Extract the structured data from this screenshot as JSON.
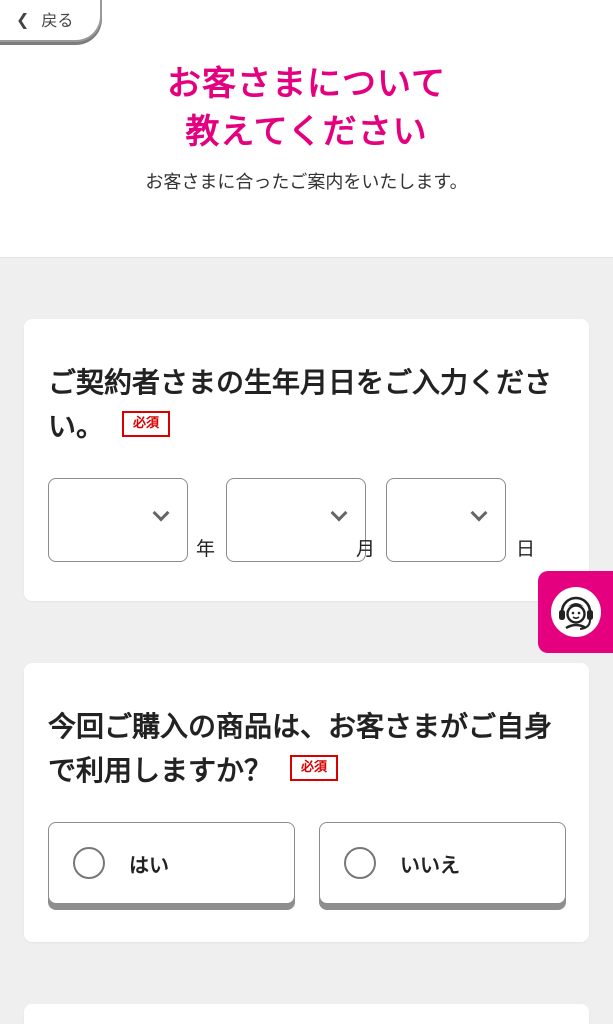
{
  "header": {
    "back_label": "戻る",
    "title_line1": "お客さまについて",
    "title_line2": "教えてください",
    "subtitle": "お客さまに合ったご案内をいたします。"
  },
  "birthdate": {
    "question": "ご契約者さまの生年月日をご入力ください。",
    "required_label": "必須",
    "year_unit": "年",
    "month_unit": "月",
    "day_unit": "日",
    "year_value": "",
    "month_value": "",
    "day_value": ""
  },
  "self_use": {
    "question": "今回ご購入の商品は、お客さまがご自身で利用しますか？",
    "required_label": "必須",
    "options": [
      {
        "label": "はい",
        "selected": false
      },
      {
        "label": "いいえ",
        "selected": false
      }
    ]
  },
  "icons": {
    "back": "chevron-left-icon",
    "dropdown": "chevron-down-icon",
    "support": "operator-headset-icon"
  },
  "colors": {
    "accent": "#e4007f",
    "required": "#d90000",
    "background": "#efefef"
  }
}
